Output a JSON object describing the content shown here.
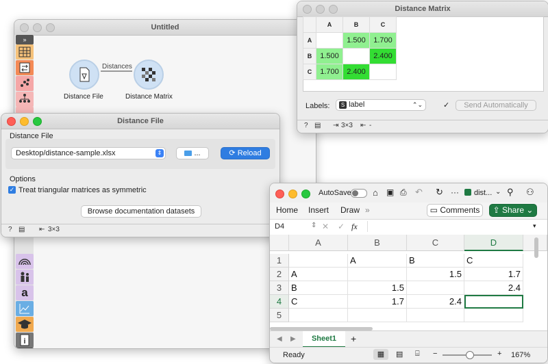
{
  "untitled": {
    "title": "Untitled",
    "nodes": [
      {
        "label": "Distance File"
      },
      {
        "label": "Distance Matrix"
      }
    ],
    "link_label": "Distances"
  },
  "distance_matrix": {
    "title": "Distance Matrix",
    "columns": [
      "A",
      "B",
      "C"
    ],
    "rows": [
      {
        "label": "A",
        "cells": [
          "",
          "1.500",
          "1.700"
        ]
      },
      {
        "label": "B",
        "cells": [
          "1.500",
          "",
          "2.400"
        ]
      },
      {
        "label": "C",
        "cells": [
          "1.700",
          "2.400",
          ""
        ]
      }
    ],
    "labels_caption": "Labels:",
    "labels_value": "label",
    "send_auto": "Send Automatically",
    "status_in": "3×3",
    "status_out": "-",
    "colors": {
      "light": "#90f090",
      "strong": "#33dd33"
    }
  },
  "distance_file": {
    "title": "Distance File",
    "section_file": "Distance File",
    "path": "Desktop/distance-sample.xlsx",
    "browse_dots": "...",
    "reload": "Reload",
    "section_options": "Options",
    "symmetric_label": "Treat triangular matrices as symmetric",
    "browse_docs": "Browse documentation datasets",
    "status_out": "3×3"
  },
  "excel": {
    "autosave": "AutoSave",
    "file_name": "dist...",
    "menu": [
      "Home",
      "Insert",
      "Draw"
    ],
    "comments": "Comments",
    "share": "Share",
    "cell_ref": "D4",
    "fx": "fx",
    "columns": [
      "A",
      "B",
      "C",
      "D"
    ],
    "rows": [
      {
        "num": "1",
        "cells": [
          "",
          "A",
          "B",
          "C"
        ]
      },
      {
        "num": "2",
        "cells": [
          "A",
          "",
          "1.5",
          "1.7"
        ]
      },
      {
        "num": "3",
        "cells": [
          "B",
          "1.5",
          "",
          "2.4"
        ]
      },
      {
        "num": "4",
        "cells": [
          "C",
          "1.7",
          "2.4",
          ""
        ]
      },
      {
        "num": "5",
        "cells": [
          "",
          "",
          "",
          ""
        ]
      }
    ],
    "sheet_tab": "Sheet1",
    "status": "Ready",
    "zoom": "167%"
  }
}
